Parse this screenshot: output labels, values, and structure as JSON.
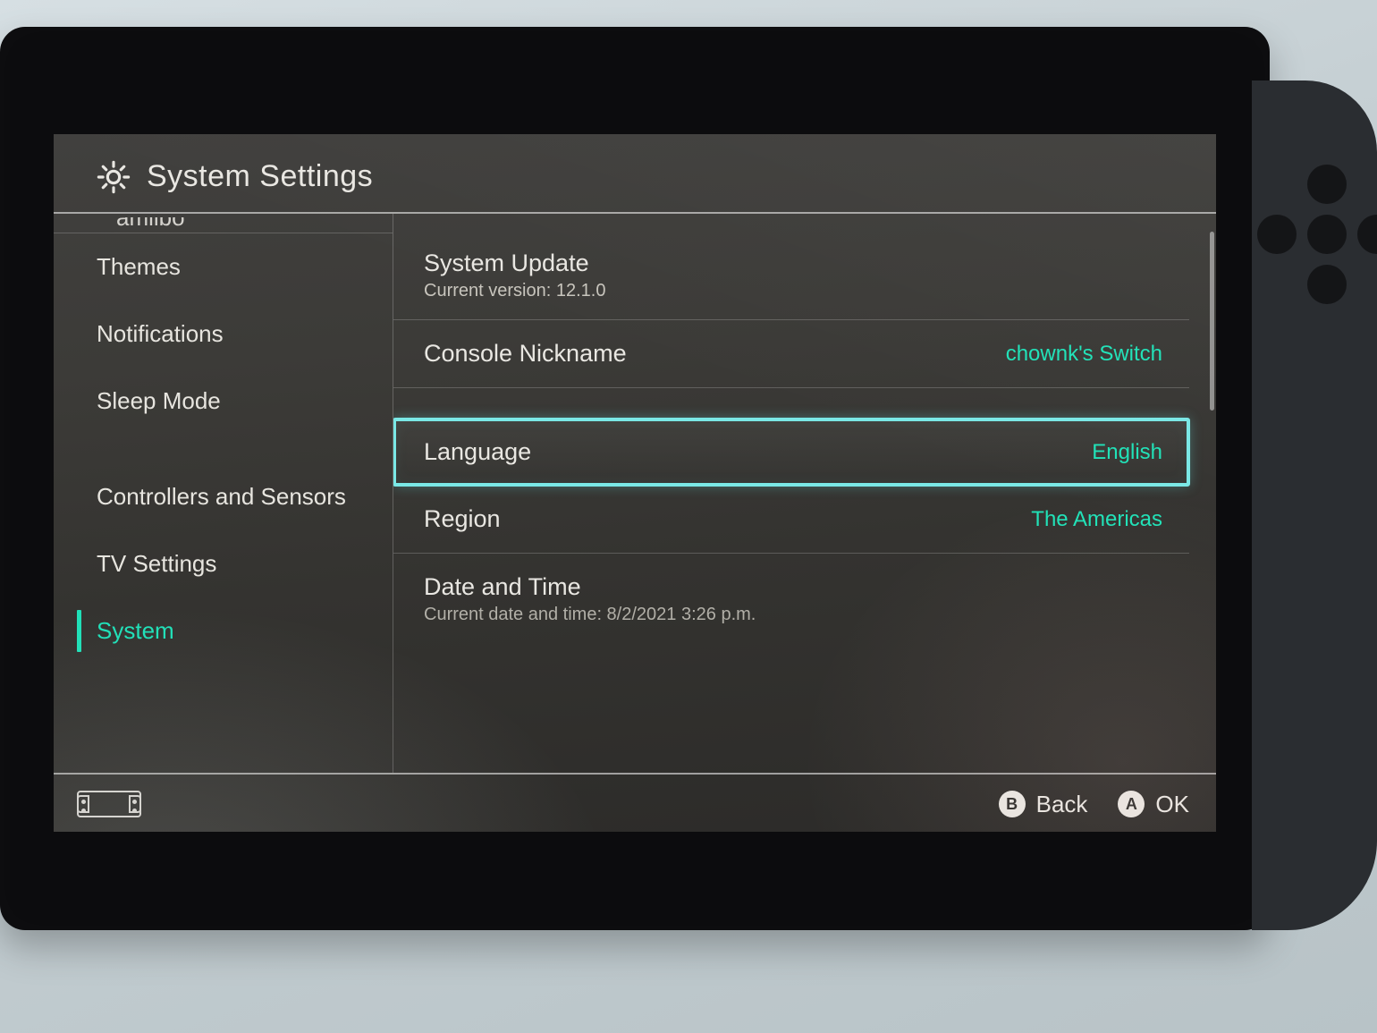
{
  "header": {
    "title": "System Settings"
  },
  "sidebar": {
    "cutoff_label": "amiibo",
    "items": [
      {
        "label": "Themes"
      },
      {
        "label": "Notifications"
      },
      {
        "label": "Sleep Mode"
      },
      {
        "label": "Controllers and Sensors"
      },
      {
        "label": "TV Settings"
      },
      {
        "label": "System",
        "active": true
      }
    ]
  },
  "main": {
    "system_update": {
      "label": "System Update",
      "subtext": "Current version: 12.1.0"
    },
    "console_nickname": {
      "label": "Console Nickname",
      "value": "chownk's Switch"
    },
    "language": {
      "label": "Language",
      "value": "English"
    },
    "region": {
      "label": "Region",
      "value": "The Americas"
    },
    "date_time": {
      "label": "Date and Time",
      "subtext": "Current date and time: 8/2/2021 3:26 p.m."
    }
  },
  "footer": {
    "back": {
      "button_glyph": "B",
      "label": "Back"
    },
    "ok": {
      "button_glyph": "A",
      "label": "OK"
    }
  }
}
